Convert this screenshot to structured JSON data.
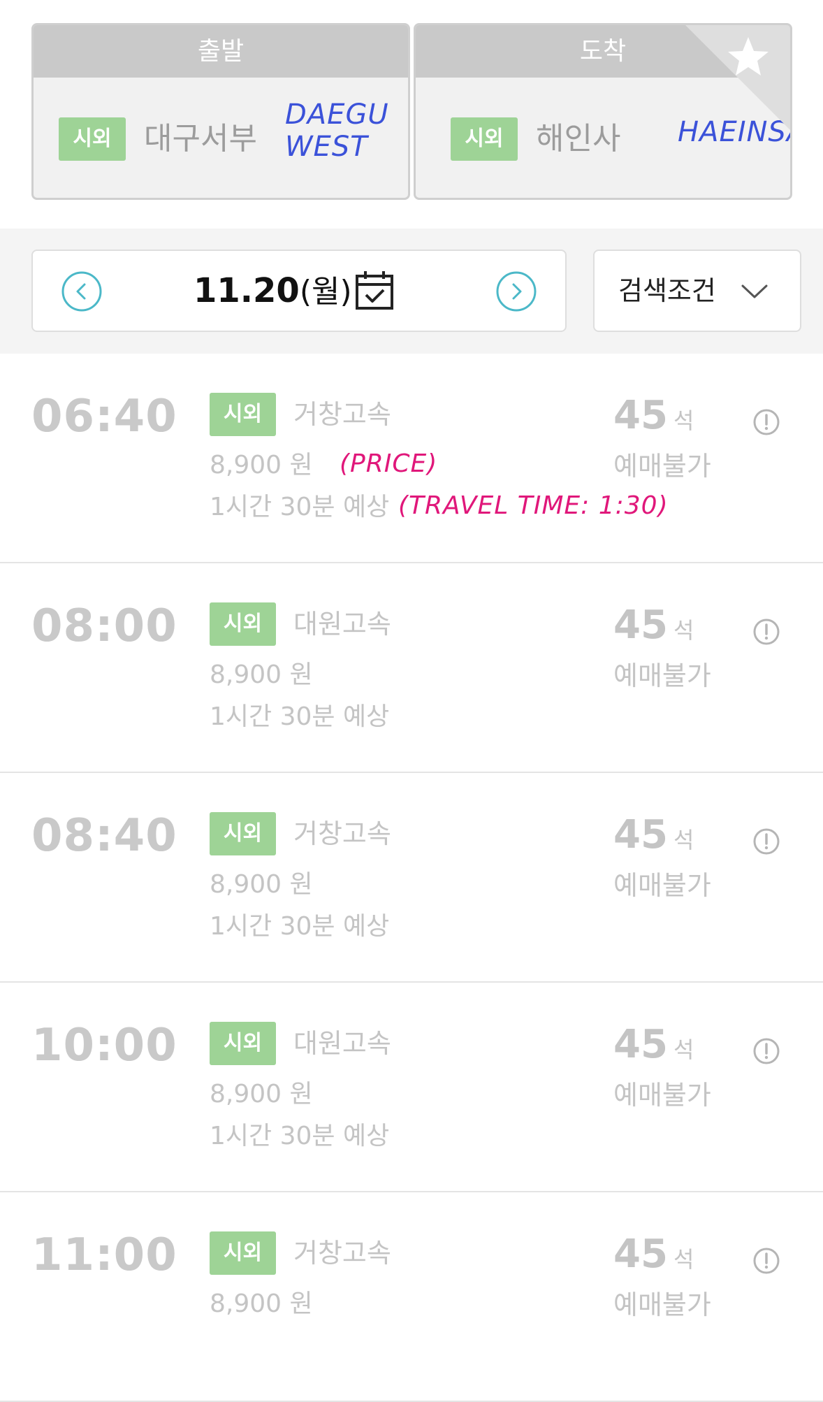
{
  "route": {
    "departure": {
      "header": "출발",
      "badge": "시외",
      "station": "대구서부",
      "annotation_line1": "DAEGU",
      "annotation_line2": "WEST"
    },
    "arrival": {
      "header": "도착",
      "badge": "시외",
      "station": "해인사",
      "annotation": "HAEINSA"
    },
    "favorite_icon": "star-icon"
  },
  "datebar": {
    "date": "11.20",
    "weekday": "(월)",
    "prev_icon": "chevron-left-circle-icon",
    "next_icon": "chevron-right-circle-icon",
    "calendar_icon": "calendar-check-icon",
    "filter_label": "검색조건",
    "filter_icon": "chevron-down-icon"
  },
  "annotations": {
    "price": "(PRICE)",
    "travel_time": "(TRAVEL TIME: 1:30)"
  },
  "schedules": [
    {
      "time": "06:40",
      "badge": "시외",
      "company": "거창고속",
      "price": "8,900 원",
      "duration": "1시간 30분 예상",
      "seats": "45",
      "seat_unit": "석",
      "status": "예매불가"
    },
    {
      "time": "08:00",
      "badge": "시외",
      "company": "대원고속",
      "price": "8,900 원",
      "duration": "1시간 30분 예상",
      "seats": "45",
      "seat_unit": "석",
      "status": "예매불가"
    },
    {
      "time": "08:40",
      "badge": "시외",
      "company": "거창고속",
      "price": "8,900 원",
      "duration": "1시간 30분 예상",
      "seats": "45",
      "seat_unit": "석",
      "status": "예매불가"
    },
    {
      "time": "10:00",
      "badge": "시외",
      "company": "대원고속",
      "price": "8,900 원",
      "duration": "1시간 30분 예상",
      "seats": "45",
      "seat_unit": "석",
      "status": "예매불가"
    },
    {
      "time": "11:00",
      "badge": "시외",
      "company": "거창고속",
      "price": "8,900 원",
      "duration": "",
      "seats": "45",
      "seat_unit": "석",
      "status": "예매불가"
    }
  ],
  "colors": {
    "badge_green": "#9ed396",
    "header_gray": "#c9c9c9",
    "teal_accent": "#4bb8c8",
    "annotation_blue": "#3b52d9",
    "annotation_pink": "#e0177a"
  }
}
